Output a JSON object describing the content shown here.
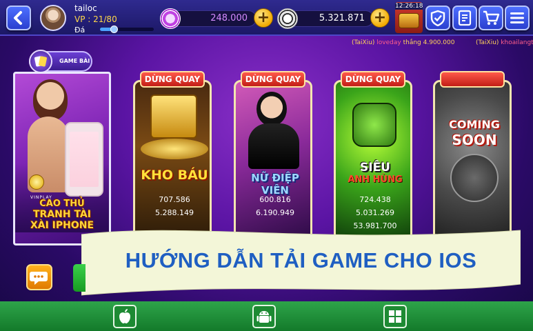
{
  "header": {
    "username": "tailoc",
    "vp_label": "VP : 21/80",
    "rank_label": "Đá",
    "vp_progress": 0.2625,
    "coins_1": "248.000",
    "coins_2": "5.321.871",
    "clock": "12:26:18"
  },
  "ticker": [
    {
      "game": "(TaiXiu)",
      "player": "loveday",
      "text": "thắng 4.900.000"
    },
    {
      "game": "(TaiXiu)",
      "player": "khoailangti",
      "text": ""
    }
  ],
  "game_bai": {
    "tab_label": "GAME BÀI",
    "brand": "VINPLAY",
    "title_line1": "CAO THỦ",
    "title_line2": "TRANH TÀI",
    "title_line3": "XÀI IPHONE"
  },
  "slots": [
    {
      "status": "DỪNG QUAY",
      "name": "KHO BÁU",
      "jackpots": [
        "707.586",
        "5.288.149"
      ]
    },
    {
      "status": "DỪNG QUAY",
      "name": "NỮ ĐIỆP VIÊN",
      "jackpots": [
        "600.816",
        "6.190.949"
      ]
    },
    {
      "status": "DỪNG QUAY",
      "name_line1": "SIÊU",
      "name_line2": "ANH HÙNG",
      "jackpots": [
        "724.438",
        "5.031.269",
        "53.981.700"
      ]
    },
    {
      "status": "",
      "name_line1": "COMING",
      "name_line2": "SOON"
    }
  ],
  "banner": {
    "text": "HƯỚNG DẪN TẢI GAME CHO IOS"
  },
  "colors": {
    "top_bar": "#1c1866",
    "accent_blue": "#2a3fcf",
    "gold": "#ffd63a",
    "banner_text": "#1f5fc2",
    "bottom_green": "#137a2a"
  },
  "icons": [
    "back-icon",
    "chip-icon",
    "plus-icon",
    "shield-icon",
    "document-icon",
    "cart-icon",
    "menu-icon",
    "chat-icon",
    "apple-icon",
    "android-icon",
    "windows-icon"
  ]
}
